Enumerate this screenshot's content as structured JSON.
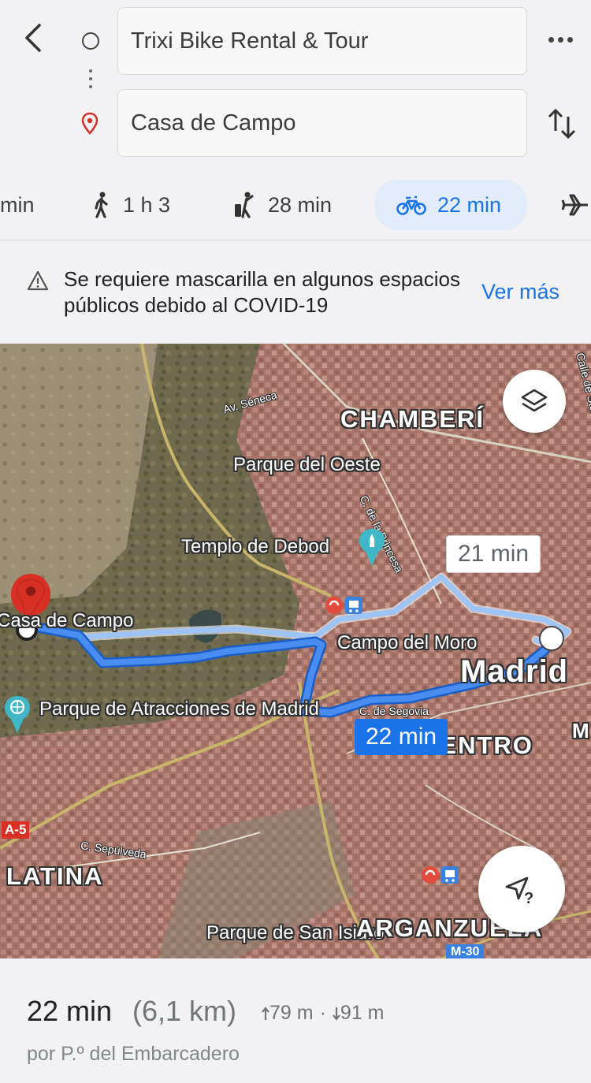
{
  "directions": {
    "origin": "Trixi Bike Rental & Tour",
    "destination": "Casa de Campo"
  },
  "modes": [
    {
      "id": "drive",
      "label": "min"
    },
    {
      "id": "walk",
      "label": "1 h 3"
    },
    {
      "id": "ride",
      "label": "28 min"
    },
    {
      "id": "bike",
      "label": "22 min",
      "active": true
    },
    {
      "id": "flight",
      "label": ""
    }
  ],
  "notice": {
    "text": "Se requiere mascarilla en algunos espacios públicos debido al COVID-19",
    "action": "Ver más"
  },
  "map": {
    "labels": {
      "chamberi": "CHAMBERÍ",
      "parque_oeste": "Parque del Oeste",
      "av_seneca": "Av. Séneca",
      "c_princesa": "C. de la Princesa",
      "calle_sta": "Calle de Sta Engra",
      "templo_debod": "Templo de Debod",
      "campo_moro": "Campo del Moro",
      "madrid": "Madrid",
      "centro": "CENTRO",
      "c_segovia": "C. de Segovia",
      "casa_campo": "Casa de Campo",
      "parque_atracciones": "Parque de Atracciones de Madrid",
      "a5": "A-5",
      "c_sepulveda": "C. Sepúlveda",
      "latina": "LATINA",
      "arganzuela": "ARGANZUELA",
      "parque_san_isidro": "Parque de San Isidro",
      "m30": "M-30",
      "m_edge": "M"
    },
    "route_time_alt": "21 min",
    "route_time_main": "22 min",
    "colors": {
      "route": "#4a8df0",
      "route_alt": "#9ec3f5",
      "pin": "#d93025"
    }
  },
  "summary": {
    "duration": "22 min",
    "distance": "(6,1 km)",
    "ascent": "79 m",
    "separator": "·",
    "descent": "91 m",
    "via": "por P.º del Embarcadero"
  }
}
